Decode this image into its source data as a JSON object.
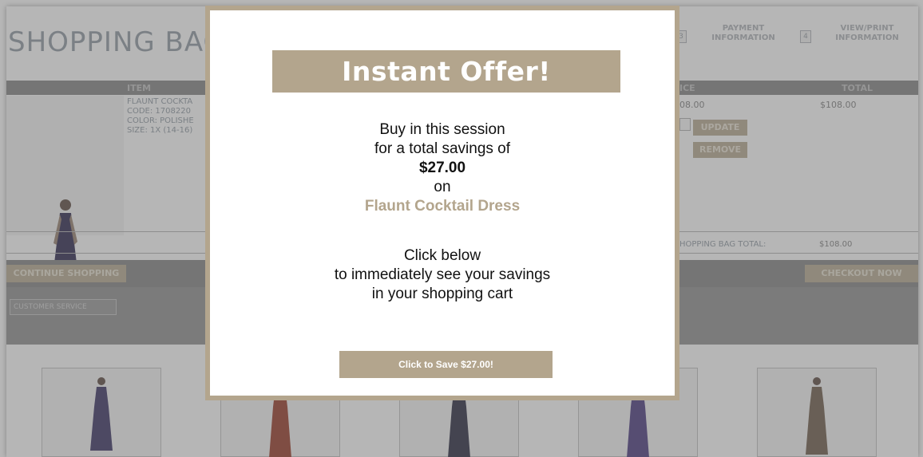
{
  "page": {
    "title": "SHOPPING BAG",
    "steps": [
      {
        "number": "3",
        "label_line1": "PAYMENT",
        "label_line2": "INFORMATION"
      },
      {
        "number": "4",
        "label_line1": "VIEW/PRINT",
        "label_line2": "INFORMATION"
      }
    ],
    "table_headers": {
      "item": "ITEM",
      "price": "ICE",
      "total": "TOTAL"
    },
    "item": {
      "name": "FLAUNT COCKTA",
      "code": "CODE: 1708220",
      "color": "COLOR: POLISHE",
      "size": "SIZE: 1X (14-16)",
      "price": "08.00",
      "total": "$108.00"
    },
    "buttons": {
      "update": "UPDATE",
      "remove": "REMOVE",
      "continue_shopping": "CONTINUE SHOPPING",
      "checkout_now": "CHECKOUT NOW",
      "customer_service": "CUSTOMER SERVICE"
    },
    "bag_total_label": "HOPPING BAG TOTAL:",
    "bag_total_value": "$108.00"
  },
  "modal": {
    "headline": "Instant Offer!",
    "line1": "Buy in this session",
    "line2": "for a total savings of",
    "savings": "$27.00",
    "line3": "on",
    "product": "Flaunt Cocktail Dress",
    "line4": "Click below",
    "line5": "to immediately see your savings",
    "line6": "in your shopping cart",
    "cta": "Click to Save $27.00!"
  },
  "colors": {
    "accent": "#b3a58d",
    "overlay_gray": "#8f8f8f"
  }
}
